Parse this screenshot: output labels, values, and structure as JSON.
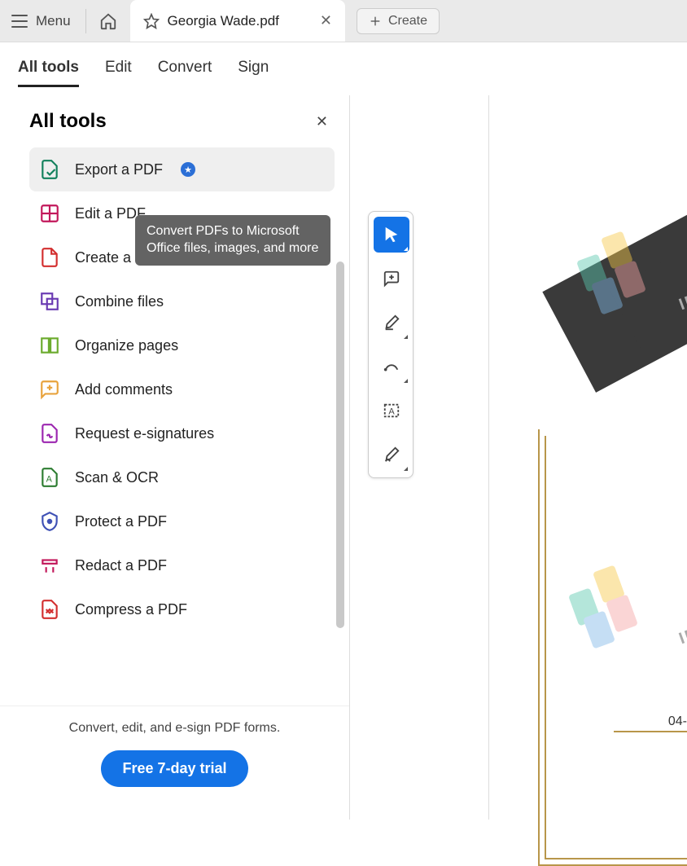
{
  "topbar": {
    "menu_label": "Menu",
    "tab_title": "Georgia Wade.pdf",
    "create_label": "Create"
  },
  "navtabs": {
    "items": [
      "All tools",
      "Edit",
      "Convert",
      "Sign"
    ],
    "active": 0
  },
  "sidebar": {
    "title": "All tools",
    "items": [
      {
        "label": "Export a PDF",
        "icon": "export-pdf",
        "color": "#12805c",
        "badge": true
      },
      {
        "label": "Edit a PDF",
        "icon": "edit-pdf",
        "color": "#c2185b"
      },
      {
        "label": "Create a PDF",
        "icon": "create-pdf",
        "color": "#d32f2f"
      },
      {
        "label": "Combine files",
        "icon": "combine",
        "color": "#6a3ab2"
      },
      {
        "label": "Organize pages",
        "icon": "organize",
        "color": "#6cab2e"
      },
      {
        "label": "Add comments",
        "icon": "comments",
        "color": "#e8a33d"
      },
      {
        "label": "Request e-signatures",
        "icon": "esign",
        "color": "#9c27b0"
      },
      {
        "label": "Scan & OCR",
        "icon": "scan",
        "color": "#2e7d32"
      },
      {
        "label": "Protect a PDF",
        "icon": "protect",
        "color": "#3f51b5"
      },
      {
        "label": "Redact a PDF",
        "icon": "redact",
        "color": "#c2185b"
      },
      {
        "label": "Compress a PDF",
        "icon": "compress",
        "color": "#d32f2f"
      }
    ],
    "tooltip": "Convert PDFs to Microsoft Office files, images, and more",
    "promo_text": "Convert, edit, and e-sign PDF forms.",
    "trial_button": "Free 7-day trial"
  },
  "vtoolbar": {
    "tools": [
      "select",
      "comment",
      "highlight",
      "draw",
      "text-select",
      "sign"
    ]
  },
  "document": {
    "date_fragment": "04-",
    "watermark_text": "IRC"
  }
}
